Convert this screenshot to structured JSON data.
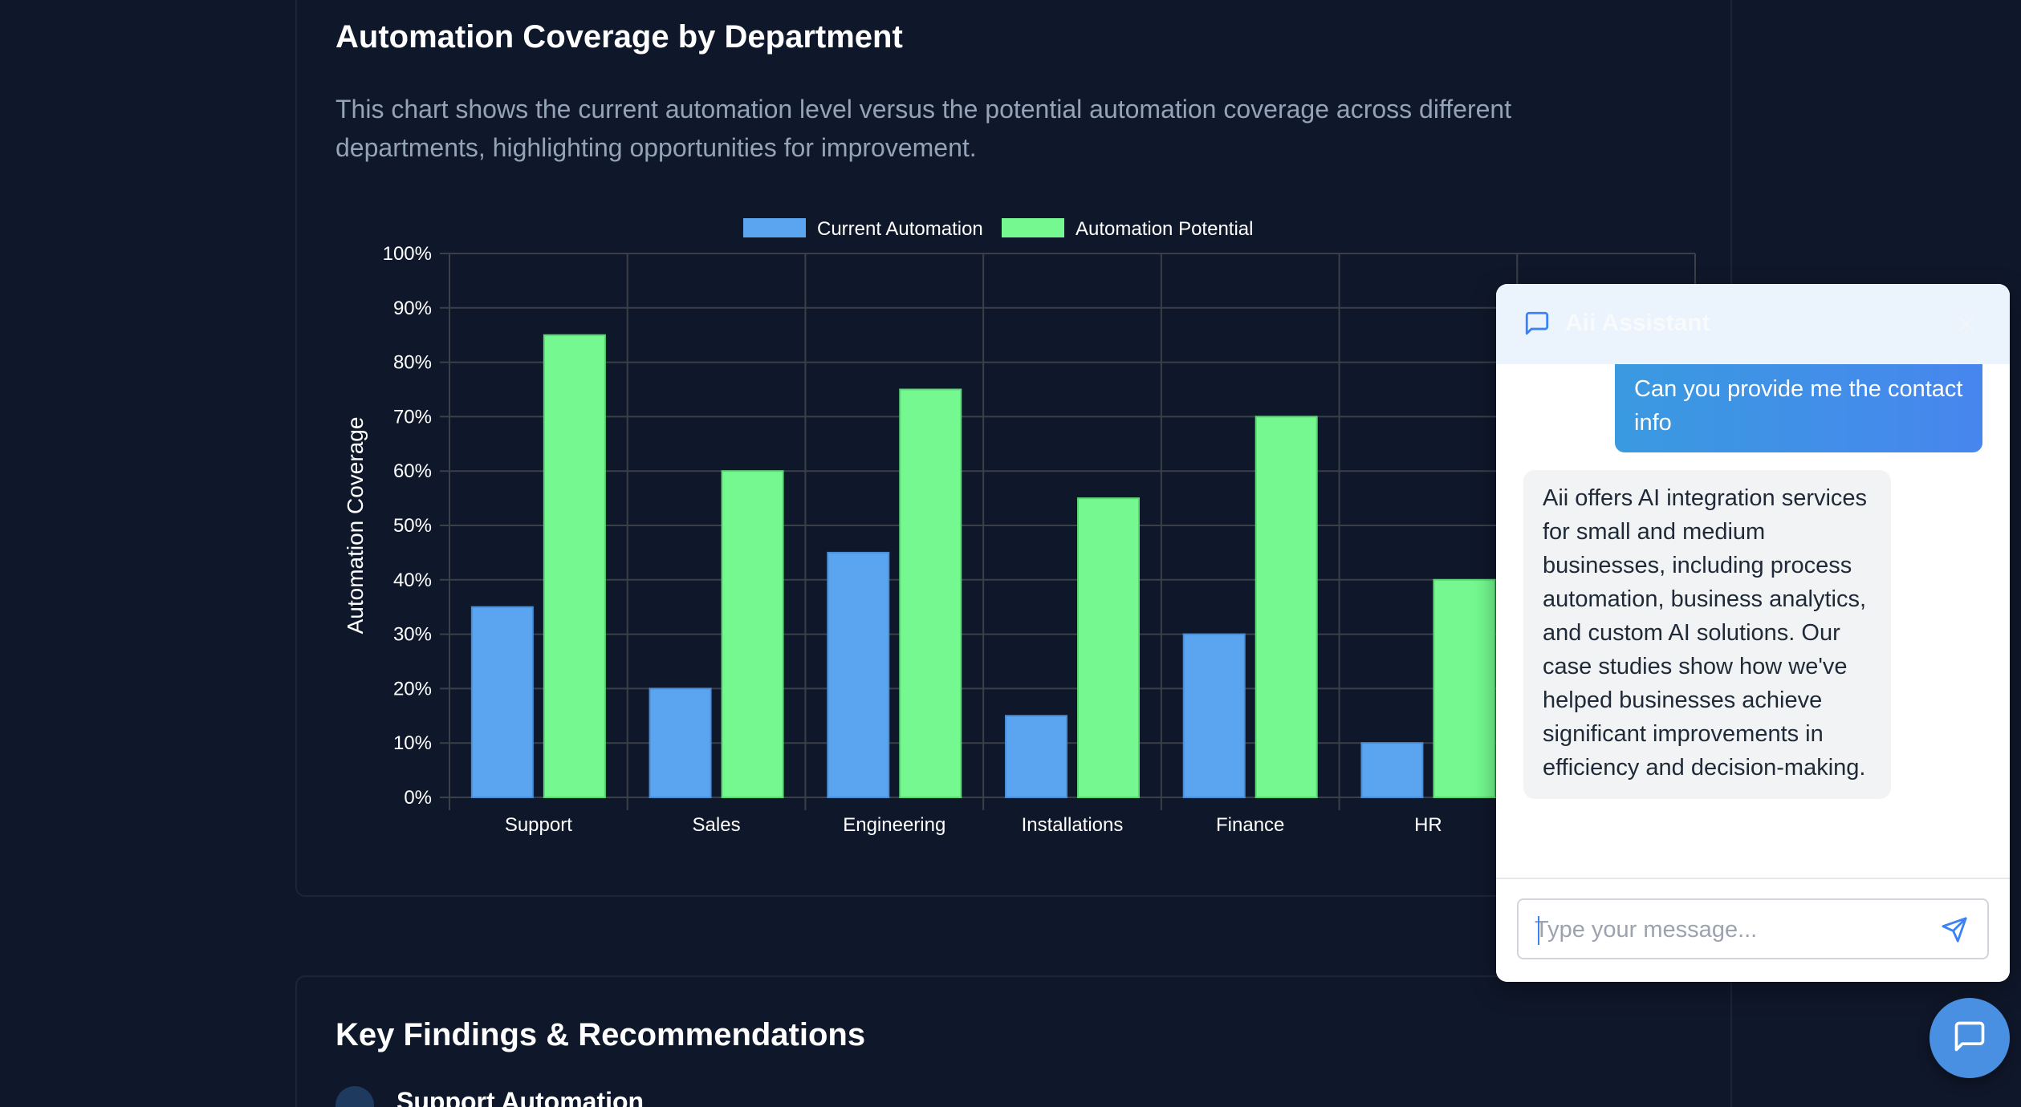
{
  "chart_section": {
    "title": "Automation Coverage by Department",
    "description": "This chart shows the current automation level versus the potential automation coverage across different departments, highlighting opportunities for improvement."
  },
  "chart_data": {
    "type": "bar",
    "categories": [
      "Support",
      "Sales",
      "Engineering",
      "Installations",
      "Finance",
      "HR",
      ""
    ],
    "series": [
      {
        "name": "Current Automation",
        "values": [
          35,
          20,
          45,
          15,
          30,
          10
        ],
        "color": "#5ba4f0"
      },
      {
        "name": "Automation Potential",
        "values": [
          85,
          60,
          75,
          55,
          70,
          40
        ],
        "color": "#74f88f"
      }
    ],
    "ylabel": "Automation Coverage",
    "ylim": [
      0,
      100
    ],
    "yticks": [
      "0%",
      "10%",
      "20%",
      "30%",
      "40%",
      "50%",
      "60%",
      "70%",
      "80%",
      "90%",
      "100%"
    ],
    "legend_position": "top-center",
    "grid": true
  },
  "findings_section": {
    "title": "Key Findings & Recommendations",
    "first_item": "Support Automation"
  },
  "chat": {
    "title": "Aii Assistant",
    "user_message": "Can you provide me the contact info",
    "bot_message": "Aii offers AI integration services for small and medium businesses, including process automation, business analytics, and custom AI solutions. Our case studies show how we've helped businesses achieve significant improvements in efficiency and decision-making.",
    "input_placeholder": "Type your message..."
  },
  "colors": {
    "background": "#0f172a",
    "accent": "#4a90e2",
    "current": "#5ba4f0",
    "potential": "#74f88f"
  }
}
